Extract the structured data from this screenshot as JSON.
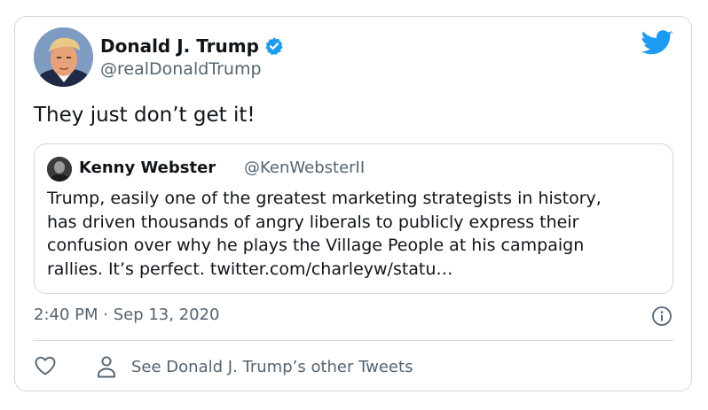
{
  "author": {
    "name": "Donald J. Trump",
    "handle": "@realDonaldTrump",
    "verified": true
  },
  "tweet": {
    "text": "They just don’t get it!",
    "timestamp": "2:40 PM · Sep 13, 2020"
  },
  "quoted": {
    "name": "Kenny Webster",
    "handle": "@KenWebsterII",
    "lines": [
      "Trump, easily one of the greatest marketing strategists in history,",
      "has driven thousands of angry liberals to publicly express their",
      "confusion over why he plays the Village People at his campaign",
      "rallies. It’s perfect. twitter.com/charleyw/statu…"
    ]
  },
  "actions": {
    "other_tweets_label": "See Donald J. Trump’s other Tweets"
  },
  "icons": {
    "brand": "twitter-bird-icon",
    "verified": "verified-badge-icon",
    "info": "info-icon",
    "like": "heart-icon",
    "profile": "person-icon"
  },
  "colors": {
    "twitter_blue": "#1d9bf0",
    "text": "#0f1419",
    "secondary_text": "#536471",
    "border": "#cfd9de"
  }
}
